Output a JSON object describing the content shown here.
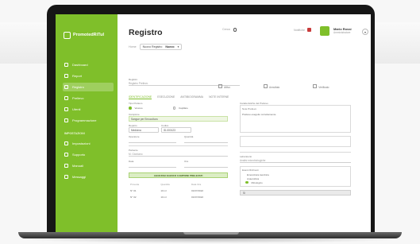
{
  "app": {
    "logo_text": "PromotedRiTuI",
    "page_title": "Registro"
  },
  "nav": {
    "items": [
      {
        "label": "Dashboard",
        "icon": "grid-icon"
      },
      {
        "label": "Report",
        "icon": "chart-icon"
      },
      {
        "label": "Registro",
        "icon": "list-icon",
        "active": true
      },
      {
        "label": "Prelievo",
        "icon": "drop-icon"
      },
      {
        "label": "Utenti",
        "icon": "user-icon"
      },
      {
        "label": "Programmazione",
        "icon": "calendar-icon"
      }
    ],
    "section_label": "IMPOSTAZIONI",
    "items2": [
      {
        "label": "Impostazioni",
        "icon": "gear-icon"
      },
      {
        "label": "Supporto",
        "icon": "help-icon"
      },
      {
        "label": "Manuali",
        "icon": "book-icon"
      },
      {
        "label": "Messaggi",
        "icon": "chat-icon"
      }
    ]
  },
  "header": {
    "breadcrumb_prefix": "Home",
    "breadcrumb_select_label": "Nuovo Registro",
    "breadcrumb_select_value": "Nuovo",
    "search_label": "Cerca",
    "notif_label": "Notifiche",
    "user_name": "Mario Rossi",
    "user_role": "Amministratore",
    "user_menu_glyph": "▾"
  },
  "form": {
    "registro_label": "Registro",
    "registro_placeholder": "Registro Prelievo",
    "checks": [
      "Attivo",
      "Annullato",
      "Verificato"
    ],
    "tabs": [
      "IDENTIFICAZIONE",
      "ESECUZIONE",
      "ANTIBIOGRAMMA",
      "NOTE INTERNE"
    ],
    "radio_label": "Tipo Prelievo",
    "radio_options": [
      "Venoso",
      "Capillare"
    ],
    "campione_label": "Campione",
    "campione_value": "Sangue per Emocoltura",
    "reparto_label": "Reparto",
    "reparto_value": "Medicina",
    "codice_label": "Codice",
    "codice_value": "ID-000123",
    "operatore_label": "Operatore",
    "quantita_label": "Quantità",
    "paziente_label": "Paziente",
    "paziente_value": "M. Giordano",
    "data_label": "Data",
    "ora_label": "Ora",
    "add_button": "AGGIUNGI ELENCO CAMPIONI PRELEVATI",
    "table_headers": [
      "Provetta",
      "Quantità",
      "Data Ora"
    ],
    "table_rows": [
      [
        "N° 01",
        "10 ml",
        "01/07/2022"
      ],
      [
        "N° 02",
        "10 ml",
        "01/07/2022"
      ]
    ],
    "right_header": "Caratteristiche del Prelievo",
    "right_sub": "Note Prelievo",
    "right_sub_value": "Prelievo eseguito correttamente",
    "right_lower_label": "Laboratorio",
    "right_lower_value": "Analisi microbiologiche",
    "group_label": "Esami Richiesti",
    "group_items": [
      "Emocoltura Aerobica",
      "Anaerobica",
      "Micologico"
    ],
    "bottom_select": "Sì"
  }
}
